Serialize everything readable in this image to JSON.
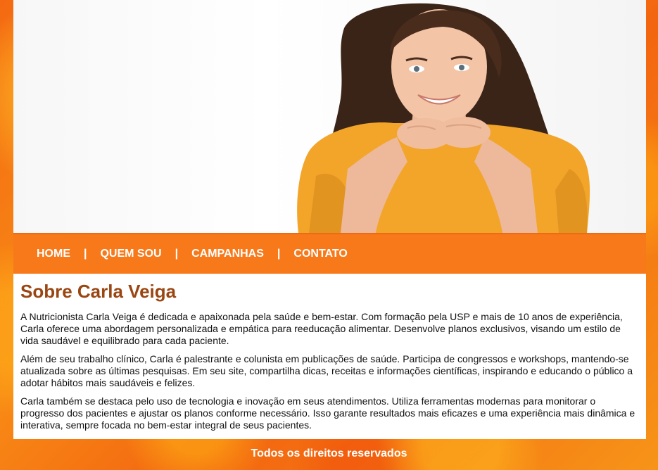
{
  "hero": {
    "image_alt": "Mulher sorridente com camiseta amarela"
  },
  "nav": {
    "items": [
      {
        "label": "HOME"
      },
      {
        "label": "QUEM SOU"
      },
      {
        "label": "CAMPANHAS"
      },
      {
        "label": "CONTATO"
      }
    ],
    "separator": "|"
  },
  "main": {
    "title": "Sobre Carla Veiga",
    "paragraphs": [
      "A Nutricionista Carla Veiga é dedicada e apaixonada pela saúde e bem-estar. Com formação pela USP e mais de 10 anos de experiência, Carla oferece uma abordagem personalizada e empática para reeducação alimentar. Desenvolve planos exclusivos, visando um estilo de vida saudável e equilibrado para cada paciente.",
      "Além de seu trabalho clínico, Carla é palestrante e colunista em publicações de saúde. Participa de congressos e workshops, mantendo-se atualizada sobre as últimas pesquisas. Em seu site, compartilha dicas, receitas e informações científicas, inspirando e educando o público a adotar hábitos mais saudáveis e felizes.",
      "Carla também se destaca pelo uso de tecnologia e inovação em seus atendimentos. Utiliza ferramentas modernas para monitorar o progresso dos pacientes e ajustar os planos conforme necessário. Isso garante resultados mais eficazes e uma experiência mais dinâmica e interativa, sempre focada no bem-estar integral de seus pacientes."
    ]
  },
  "footer": {
    "text": "Todos os direitos reservados"
  },
  "colors": {
    "accent": "#f7791a",
    "title": "#9a4612"
  }
}
